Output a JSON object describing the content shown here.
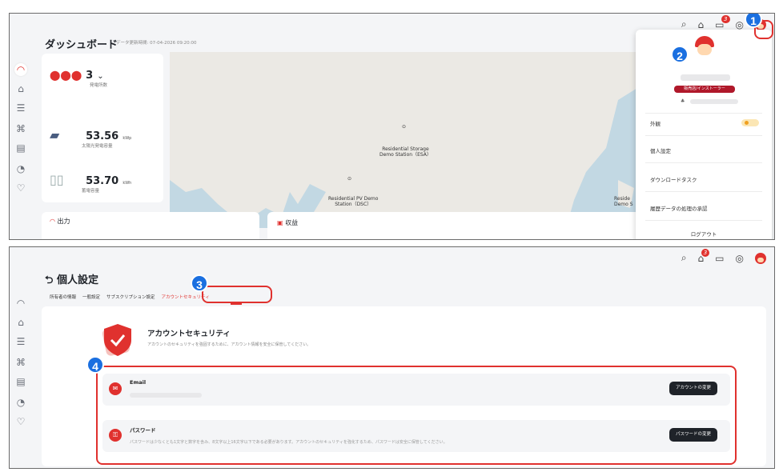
{
  "header_icons": [
    "search-icon",
    "station-icon",
    "message-icon",
    "globe-icon",
    "avatar"
  ],
  "message_badge": "3",
  "callouts": [
    "1",
    "2",
    "3",
    "4"
  ],
  "dashboard": {
    "title": "ダッシュボード",
    "meta": "データ更新時間: 07-04-2026 09:20:00",
    "stats": [
      {
        "value": "3",
        "unit": "",
        "label": "発電所数"
      },
      {
        "value": "53.56",
        "unit": "kWp",
        "label": "太陽光発電容量"
      },
      {
        "value": "53.70",
        "unit": "kWh",
        "label": "蓄電容量"
      }
    ],
    "map_labels": {
      "storage_station": "Residential Storage\nDemo Station（ESA）",
      "pv_station": "Residential PV Demo\nStation（DSC）",
      "edge_label": "Reside\nDemo S"
    },
    "output_card": "出力",
    "revenue_card": "収益"
  },
  "dropdown": {
    "role": "販売店/インストーラー",
    "items": [
      "外観",
      "個人設定",
      "ダウンロードタスク",
      "履歴データの処理の承認"
    ],
    "logout": "ログアウト"
  },
  "personal": {
    "title": "個人設定",
    "tabs": [
      "所有者の情報",
      "一般設定",
      "サブスクリプション設定",
      "アカウントセキュリティ"
    ],
    "active_tab": 3,
    "security_title": "アカウントセキュリティ",
    "security_desc": "アカウントのセキュリティを強固するために、アカウント情報を安全に保管してください。",
    "email": {
      "label": "Email",
      "button": "アカウントの変更"
    },
    "password": {
      "label": "パスワード",
      "desc": "パスワードは少なくとも1文字と数字を含み、8文字以上16文字以下である必要があります。アカウントのセキュリティを強化するため、パスワードは安全に保管してください。",
      "button": "パスワードの変更"
    }
  },
  "colors": {
    "accent": "#e0312e",
    "callout": "#1a6fe0",
    "dark_button": "#1f2329"
  }
}
